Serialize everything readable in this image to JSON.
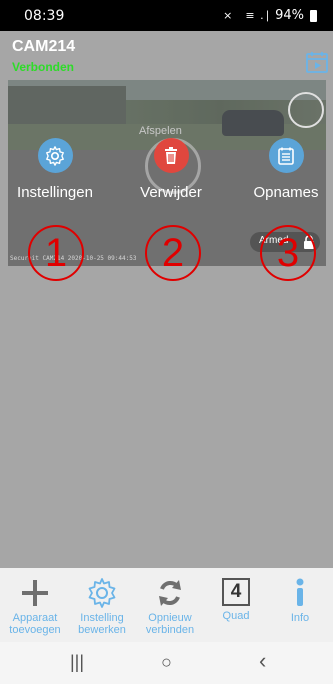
{
  "status_bar": {
    "time": "08:39",
    "icons": "× ≡ .∣",
    "battery": "94%"
  },
  "header": {
    "camera_name": "CAM214",
    "connection_status": "Verbonden",
    "calendar_icon": "calendar-play-icon"
  },
  "video": {
    "timestamp": "Secureit CAM214 2020-10-25 09:44:53",
    "play_label": "Afspelen",
    "armed_label": "Armed"
  },
  "actions": [
    {
      "label": "Instellingen",
      "icon": "gear-icon",
      "color": "#5ba4d8"
    },
    {
      "label": "Verwijder",
      "icon": "trash-icon",
      "color": "#e0473e"
    },
    {
      "label": "Opnames",
      "icon": "list-icon",
      "color": "#5ba4d8"
    }
  ],
  "markers": [
    "1",
    "2",
    "3"
  ],
  "bottom_nav": [
    {
      "label": "Apparaat\ntoevoegen",
      "icon": "plus-icon"
    },
    {
      "label": "Instelling\nbewerken",
      "icon": "gear-outline-icon"
    },
    {
      "label": "Opnieuw\nverbinden",
      "icon": "refresh-icon"
    },
    {
      "label": "Quad",
      "icon": "quad-icon",
      "quad_number": "4"
    },
    {
      "label": "Info",
      "icon": "info-icon"
    }
  ],
  "system_nav": {
    "recents": "|||",
    "home": "○",
    "back": "‹"
  },
  "colors": {
    "accent": "#6ab4e8",
    "connected": "#2ddc28",
    "marker": "#e00000",
    "delete": "#e0473e"
  }
}
